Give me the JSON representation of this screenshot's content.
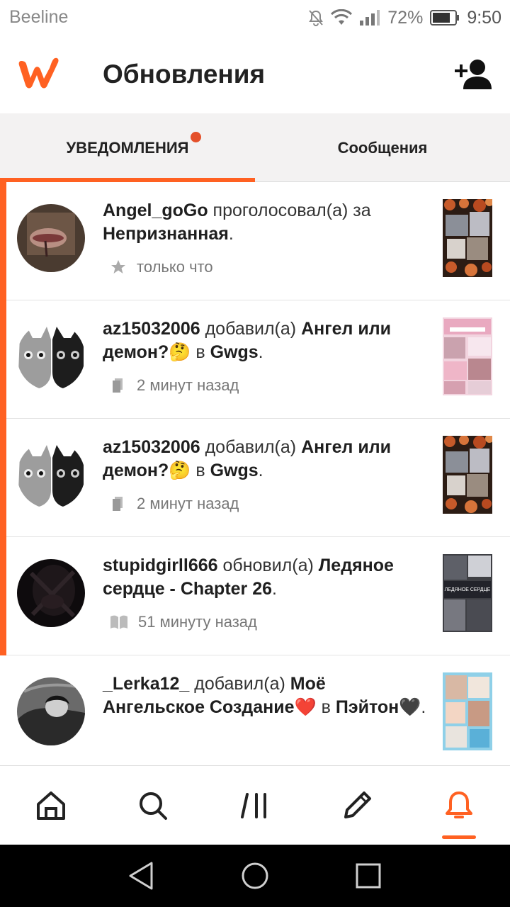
{
  "status": {
    "carrier": "Beeline",
    "battery": "72%",
    "time": "9:50"
  },
  "header": {
    "title": "Обновления"
  },
  "tabs": [
    {
      "label": "УВЕДОМЛЕНИЯ",
      "active": true,
      "has_dot": true
    },
    {
      "label": "Сообщения",
      "active": false
    }
  ],
  "notifications": [
    {
      "user": "Angel_goGo",
      "action": " проголосовал(а) за ",
      "target": "Непризнанная",
      "suffix": ".",
      "icon": "star-icon",
      "time": "только что",
      "unread": true
    },
    {
      "user": "az15032006",
      "action": " добавил(а) ",
      "target": "Ангел или демон?🤔",
      "middle": " в ",
      "list": "Gwgs",
      "suffix": ".",
      "icon": "reading-list-icon",
      "time": "2 минут назад",
      "unread": true
    },
    {
      "user": "az15032006",
      "action": " добавил(а) ",
      "target": "Ангел или демон?🤔",
      "middle": " в ",
      "list": "Gwgs",
      "suffix": ".",
      "icon": "reading-list-icon",
      "time": "2 минут назад",
      "unread": true
    },
    {
      "user": "stupidgirll666",
      "action": " обновил(а) ",
      "target": "Ледяное сердце - Chapter 26",
      "suffix": ".",
      "icon": "book-icon",
      "time": "51 минуту назад",
      "unread": true
    },
    {
      "user": "_Lerka12_",
      "action": " добавил(а) ",
      "target": "Моё Ангельское Создание❤️",
      "middle": " в ",
      "list": "Пэйтон🖤",
      "suffix": ".",
      "icon": "reading-list-icon",
      "time": "",
      "unread": false
    }
  ],
  "thumb_overlay_text": "ЛЕДЯНОЕ СЕРДЦЕ",
  "colors": {
    "accent": "#ff6122",
    "dot": "#e4502a"
  },
  "bottom_nav": [
    "home-icon",
    "search-icon",
    "library-icon",
    "write-icon",
    "notifications-icon"
  ],
  "active_nav": "notifications-icon"
}
